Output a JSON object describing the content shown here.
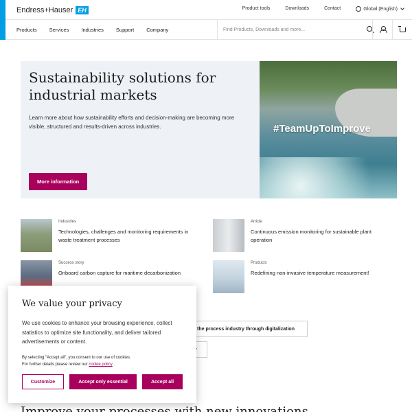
{
  "header": {
    "logo_text": "Endress+Hauser",
    "logo_badge": "EH",
    "top_links": [
      "Product tools",
      "Downloads",
      "Contact"
    ],
    "region": "Global (English)",
    "nav": [
      "Products",
      "Services",
      "Industries",
      "Support",
      "Company"
    ],
    "search_placeholder": "Find Products, Downloads and more..."
  },
  "hero": {
    "title": "Sustainability solutions for industrial markets",
    "description": "Learn more about how sustainability efforts and decision-making are becoming more visible, structured and results-driven across industries.",
    "button": "More information",
    "image_hashtag": "#TeamUpToImprove"
  },
  "cards": [
    {
      "category": "Industries",
      "title": "Technologies, challenges and monitoring requirements in waste treatment processes"
    },
    {
      "category": "Article",
      "title": "Continuous emission monitoring for sustainable plant operation"
    },
    {
      "category": "Success story",
      "title": "Onboard carbon capture for maritime decarbonization"
    },
    {
      "category": "Products",
      "title": "Redefining non-invasive temperature measurement!"
    }
  ],
  "pills": [
    "the process industry through digitalization",
    "y"
  ],
  "bottom_heading": "Improve your processes with new innovations",
  "cookie": {
    "title": "We value your privacy",
    "body": "We use cookies to enhance your browsing experience, collect statistics to optimize site functionality, and deliver tailored advertisements or content.",
    "small_text_1": "By selecting \"Accept all\", you consent to our use of cookies.",
    "small_text_2": "For further details please review our",
    "policy_link": "cookie policy",
    "small_text_end": ".",
    "btn_customize": "Customize",
    "btn_essential": "Accept only essential",
    "btn_accept": "Accept all"
  },
  "colors": {
    "accent": "#009fe3",
    "brand": "#a8005c",
    "hero_bg": "#eef2f6"
  }
}
